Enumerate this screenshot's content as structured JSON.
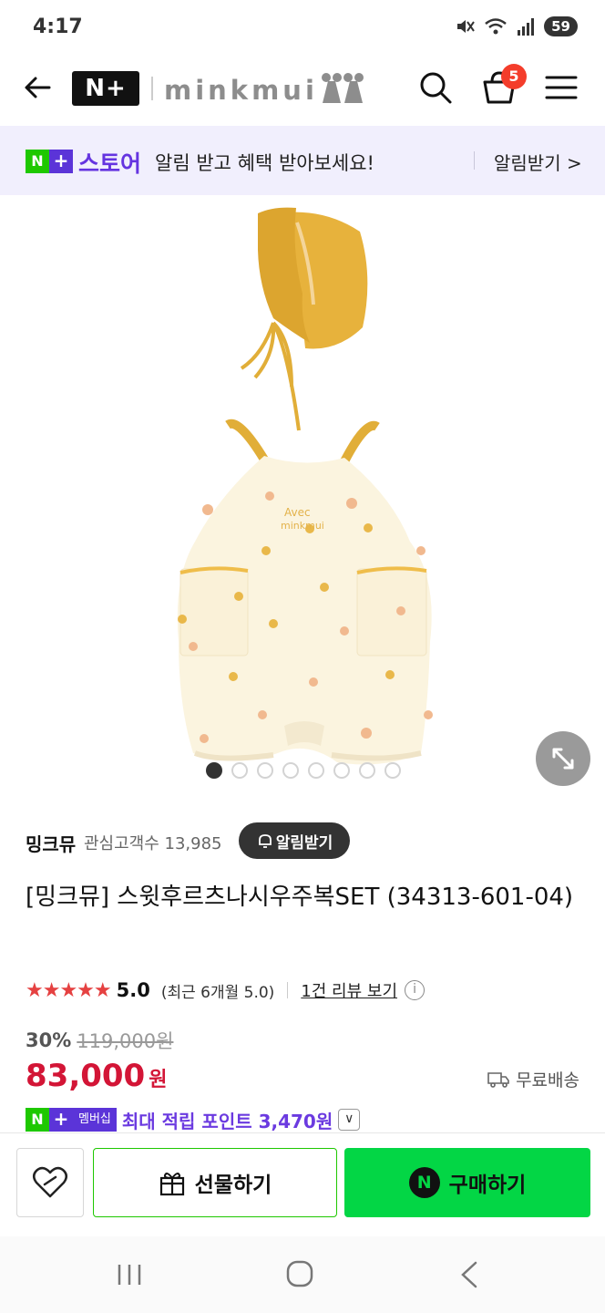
{
  "status_bar": {
    "time": "4:17",
    "battery": "59",
    "icons": [
      "mute-icon",
      "wifi-icon",
      "signal-icon",
      "battery-icon"
    ]
  },
  "header": {
    "logo_text": "N+",
    "brand_text": "minkmui",
    "cart_count": "5",
    "icons": [
      "back-arrow-icon",
      "search-icon",
      "cart-icon",
      "hamburger-menu-icon"
    ]
  },
  "promo_banner": {
    "badge_n": "N",
    "badge_plus": "+",
    "store_label": "스토어",
    "message": "알림 받고 혜택 받아보세요!",
    "cta": "알림받기 >"
  },
  "gallery": {
    "dot_count": 8,
    "active_index": 0,
    "product_text": "Avec minkmui"
  },
  "seller": {
    "name": "밍크뮤",
    "followers_label": "관심고객수 13,985",
    "notify_button": "알림받기"
  },
  "product": {
    "title": "[밍크뮤] 스윗후르츠나시우주복SET (34313-601-04)",
    "stars": "★★★★★",
    "rating": "5.0",
    "rating_recent": "(최근 6개월 5.0)",
    "review_link": "1건 리뷰 보기",
    "info_icon": "i",
    "discount_rate": "30%",
    "original_price": "119,000원",
    "sale_price": "83,000",
    "price_unit": "원",
    "shipping": "무료배송",
    "membership_label": "멤버십",
    "points_text": "최대 적립 포인트 3,470원",
    "points_toggle": "∨"
  },
  "action_bar": {
    "gift_label": "선물하기",
    "buy_label": "구매하기",
    "buy_badge": "N"
  },
  "colors": {
    "naver_green": "#03d645",
    "brand_purple": "#6534e0",
    "price_red": "#d31536",
    "star_red": "#e54141",
    "cart_badge": "#f43d2b",
    "banner_bg": "#f1effd"
  }
}
